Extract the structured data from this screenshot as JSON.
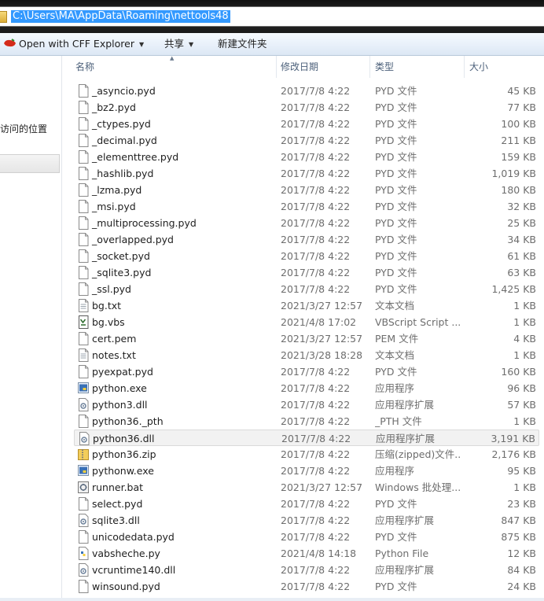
{
  "address": {
    "path": "C:\\Users\\MA\\AppData\\Roaming\\nettools48"
  },
  "toolbar": {
    "open_with": "Open with CFF Explorer",
    "share": "共享",
    "new_folder": "新建文件夹"
  },
  "nav": {
    "recent_places": "访问的位置"
  },
  "columns": {
    "name": "名称",
    "date": "修改日期",
    "type": "类型",
    "size": "大小"
  },
  "files": [
    {
      "name": "_asyncio.pyd",
      "date": "2017/7/8 4:22",
      "type": "PYD 文件",
      "size": "45 KB",
      "icon": "generic-file-icon"
    },
    {
      "name": "_bz2.pyd",
      "date": "2017/7/8 4:22",
      "type": "PYD 文件",
      "size": "77 KB",
      "icon": "generic-file-icon"
    },
    {
      "name": "_ctypes.pyd",
      "date": "2017/7/8 4:22",
      "type": "PYD 文件",
      "size": "100 KB",
      "icon": "generic-file-icon"
    },
    {
      "name": "_decimal.pyd",
      "date": "2017/7/8 4:22",
      "type": "PYD 文件",
      "size": "211 KB",
      "icon": "generic-file-icon"
    },
    {
      "name": "_elementtree.pyd",
      "date": "2017/7/8 4:22",
      "type": "PYD 文件",
      "size": "159 KB",
      "icon": "generic-file-icon"
    },
    {
      "name": "_hashlib.pyd",
      "date": "2017/7/8 4:22",
      "type": "PYD 文件",
      "size": "1,019 KB",
      "icon": "generic-file-icon"
    },
    {
      "name": "_lzma.pyd",
      "date": "2017/7/8 4:22",
      "type": "PYD 文件",
      "size": "180 KB",
      "icon": "generic-file-icon"
    },
    {
      "name": "_msi.pyd",
      "date": "2017/7/8 4:22",
      "type": "PYD 文件",
      "size": "32 KB",
      "icon": "generic-file-icon"
    },
    {
      "name": "_multiprocessing.pyd",
      "date": "2017/7/8 4:22",
      "type": "PYD 文件",
      "size": "25 KB",
      "icon": "generic-file-icon"
    },
    {
      "name": "_overlapped.pyd",
      "date": "2017/7/8 4:22",
      "type": "PYD 文件",
      "size": "34 KB",
      "icon": "generic-file-icon"
    },
    {
      "name": "_socket.pyd",
      "date": "2017/7/8 4:22",
      "type": "PYD 文件",
      "size": "61 KB",
      "icon": "generic-file-icon"
    },
    {
      "name": "_sqlite3.pyd",
      "date": "2017/7/8 4:22",
      "type": "PYD 文件",
      "size": "63 KB",
      "icon": "generic-file-icon"
    },
    {
      "name": "_ssl.pyd",
      "date": "2017/7/8 4:22",
      "type": "PYD 文件",
      "size": "1,425 KB",
      "icon": "generic-file-icon"
    },
    {
      "name": "bg.txt",
      "date": "2021/3/27 12:57",
      "type": "文本文档",
      "size": "1 KB",
      "icon": "text-file-icon"
    },
    {
      "name": "bg.vbs",
      "date": "2021/4/8 17:02",
      "type": "VBScript Script ...",
      "size": "1 KB",
      "icon": "vbscript-icon"
    },
    {
      "name": "cert.pem",
      "date": "2021/3/27 12:57",
      "type": "PEM 文件",
      "size": "4 KB",
      "icon": "generic-file-icon"
    },
    {
      "name": "notes.txt",
      "date": "2021/3/28 18:28",
      "type": "文本文档",
      "size": "1 KB",
      "icon": "text-file-icon"
    },
    {
      "name": "pyexpat.pyd",
      "date": "2017/7/8 4:22",
      "type": "PYD 文件",
      "size": "160 KB",
      "icon": "generic-file-icon"
    },
    {
      "name": "python.exe",
      "date": "2017/7/8 4:22",
      "type": "应用程序",
      "size": "96 KB",
      "icon": "python-exe-icon"
    },
    {
      "name": "python3.dll",
      "date": "2017/7/8 4:22",
      "type": "应用程序扩展",
      "size": "57 KB",
      "icon": "dll-icon"
    },
    {
      "name": "python36._pth",
      "date": "2017/7/8 4:22",
      "type": "_PTH 文件",
      "size": "1 KB",
      "icon": "generic-file-icon"
    },
    {
      "name": "python36.dll",
      "date": "2017/7/8 4:22",
      "type": "应用程序扩展",
      "size": "3,191 KB",
      "icon": "dll-icon"
    },
    {
      "name": "python36.zip",
      "date": "2017/7/8 4:22",
      "type": "压缩(zipped)文件...",
      "size": "2,176 KB",
      "icon": "zip-folder-icon"
    },
    {
      "name": "pythonw.exe",
      "date": "2017/7/8 4:22",
      "type": "应用程序",
      "size": "95 KB",
      "icon": "python-exe-icon"
    },
    {
      "name": "runner.bat",
      "date": "2021/3/27 12:57",
      "type": "Windows 批处理...",
      "size": "1 KB",
      "icon": "batch-file-icon"
    },
    {
      "name": "select.pyd",
      "date": "2017/7/8 4:22",
      "type": "PYD 文件",
      "size": "23 KB",
      "icon": "generic-file-icon"
    },
    {
      "name": "sqlite3.dll",
      "date": "2017/7/8 4:22",
      "type": "应用程序扩展",
      "size": "847 KB",
      "icon": "dll-icon"
    },
    {
      "name": "unicodedata.pyd",
      "date": "2017/7/8 4:22",
      "type": "PYD 文件",
      "size": "875 KB",
      "icon": "generic-file-icon"
    },
    {
      "name": "vabsheche.py",
      "date": "2021/4/8 14:18",
      "type": "Python File",
      "size": "12 KB",
      "icon": "python-file-icon"
    },
    {
      "name": "vcruntime140.dll",
      "date": "2017/7/8 4:22",
      "type": "应用程序扩展",
      "size": "84 KB",
      "icon": "dll-icon"
    },
    {
      "name": "winsound.pyd",
      "date": "2017/7/8 4:22",
      "type": "PYD 文件",
      "size": "24 KB",
      "icon": "generic-file-icon"
    }
  ],
  "selected_file": "python36.dll"
}
